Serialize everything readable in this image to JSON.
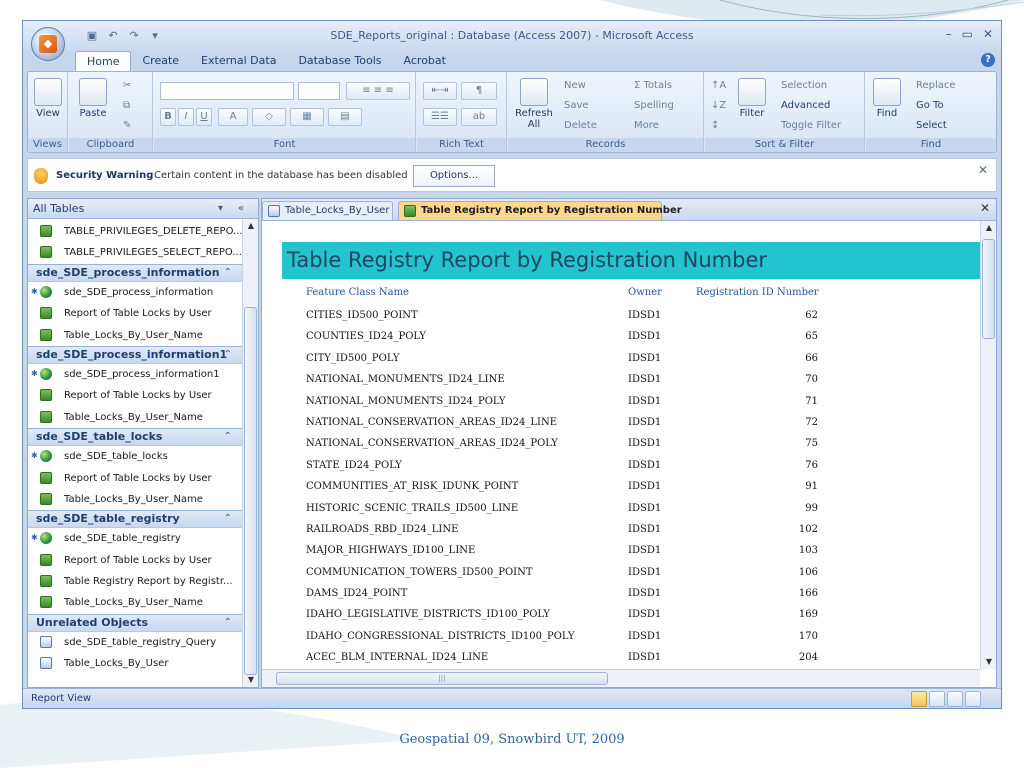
{
  "window": {
    "title": "SDE_Reports_original : Database (Access 2007) - Microsoft Access"
  },
  "quick_access": {
    "save_icon": "save-icon",
    "undo_icon": "undo-icon",
    "redo_icon": "redo-icon",
    "customize_icon": "customize-icon"
  },
  "ribbon_tabs": [
    "Home",
    "Create",
    "External Data",
    "Database Tools",
    "Acrobat"
  ],
  "ribbon": {
    "views": {
      "label": "Views",
      "view": "View"
    },
    "clipboard": {
      "label": "Clipboard",
      "paste": "Paste"
    },
    "font": {
      "label": "Font",
      "bold": "B",
      "italic": "I",
      "underline": "U"
    },
    "rich_text": {
      "label": "Rich Text"
    },
    "records": {
      "label": "Records",
      "refresh": "Refresh All",
      "new": "New",
      "save": "Save",
      "delete": "Delete",
      "totals": "Σ Totals",
      "spelling": "Spelling",
      "more": "More"
    },
    "sort_filter": {
      "label": "Sort & Filter",
      "filter": "Filter",
      "selection": "Selection",
      "advanced": "Advanced",
      "toggle": "Toggle Filter"
    },
    "find": {
      "label": "Find",
      "find": "Find",
      "replace": "Replace",
      "goto": "Go To",
      "select": "Select"
    }
  },
  "security": {
    "title": "Security Warning",
    "message": "Certain content in the database has been disabled",
    "options": "Options..."
  },
  "nav": {
    "header": "All Tables",
    "top_items": [
      {
        "label": "TABLE_PRIVILEGES_DELETE_REPO...",
        "icon": "table"
      },
      {
        "label": "TABLE_PRIVILEGES_SELECT_REPO...",
        "icon": "table"
      }
    ],
    "groups": [
      {
        "name": "sde_SDE_process_information",
        "items": [
          {
            "label": "sde_SDE_process_information",
            "icon": "globe"
          },
          {
            "label": "Report of Table Locks by User",
            "icon": "table"
          },
          {
            "label": "Table_Locks_By_User_Name",
            "icon": "table"
          }
        ]
      },
      {
        "name": "sde_SDE_process_information1",
        "items": [
          {
            "label": "sde_SDE_process_information1",
            "icon": "globe"
          },
          {
            "label": "Report of Table Locks by User",
            "icon": "table"
          },
          {
            "label": "Table_Locks_By_User_Name",
            "icon": "table"
          }
        ]
      },
      {
        "name": "sde_SDE_table_locks",
        "items": [
          {
            "label": "sde_SDE_table_locks",
            "icon": "globe"
          },
          {
            "label": "Report of Table Locks by User",
            "icon": "table"
          },
          {
            "label": "Table_Locks_By_User_Name",
            "icon": "table"
          }
        ]
      },
      {
        "name": "sde_SDE_table_registry",
        "items": [
          {
            "label": "sde_SDE_table_registry",
            "icon": "globe"
          },
          {
            "label": "Report of Table Locks by User",
            "icon": "table"
          },
          {
            "label": "Table Registry Report by Registr...",
            "icon": "table"
          },
          {
            "label": "Table_Locks_By_User_Name",
            "icon": "table"
          }
        ]
      },
      {
        "name": "Unrelated Objects",
        "items": [
          {
            "label": "sde_SDE_table_registry_Query",
            "icon": "query"
          },
          {
            "label": "Table_Locks_By_User",
            "icon": "query"
          }
        ]
      }
    ]
  },
  "doc_tabs": [
    "Table_Locks_By_User",
    "Table Registry Report by Registration Number"
  ],
  "report": {
    "title": "Table Registry Report by Registration Number",
    "headers": [
      "Feature Class Name",
      "Owner",
      "Registration ID Number"
    ],
    "rows": [
      [
        "CITIES_ID500_POINT",
        "IDSD1",
        "62"
      ],
      [
        "COUNTIES_ID24_POLY",
        "IDSD1",
        "65"
      ],
      [
        "CITY_ID500_POLY",
        "IDSD1",
        "66"
      ],
      [
        "NATIONAL_MONUMENTS_ID24_LINE",
        "IDSD1",
        "70"
      ],
      [
        "NATIONAL_MONUMENTS_ID24_POLY",
        "IDSD1",
        "71"
      ],
      [
        "NATIONAL_CONSERVATION_AREAS_ID24_LINE",
        "IDSD1",
        "72"
      ],
      [
        "NATIONAL_CONSERVATION_AREAS_ID24_POLY",
        "IDSD1",
        "75"
      ],
      [
        "STATE_ID24_POLY",
        "IDSD1",
        "76"
      ],
      [
        "COMMUNITIES_AT_RISK_IDUNK_POINT",
        "IDSD1",
        "91"
      ],
      [
        "HISTORIC_SCENIC_TRAILS_ID500_LINE",
        "IDSD1",
        "99"
      ],
      [
        "RAILROADS_RBD_ID24_LINE",
        "IDSD1",
        "102"
      ],
      [
        "MAJOR_HIGHWAYS_ID100_LINE",
        "IDSD1",
        "103"
      ],
      [
        "COMMUNICATION_TOWERS_ID500_POINT",
        "IDSD1",
        "106"
      ],
      [
        "DAMS_ID24_POINT",
        "IDSD1",
        "166"
      ],
      [
        "IDAHO_LEGISLATIVE_DISTRICTS_ID100_POLY",
        "IDSD1",
        "169"
      ],
      [
        "IDAHO_CONGRESSIONAL_DISTRICTS_ID100_POLY",
        "IDSD1",
        "170"
      ],
      [
        "ACEC_BLM_INTERNAL_ID24_LINE",
        "IDSD1",
        "204"
      ]
    ]
  },
  "status": {
    "text": "Report View"
  },
  "footer": "Geospatial 09, Snowbird UT, 2009",
  "colors": {
    "report_title_bar": "#23c4cf",
    "accent_tab": "#fbd88a",
    "footer_text": "#2b63a3"
  }
}
